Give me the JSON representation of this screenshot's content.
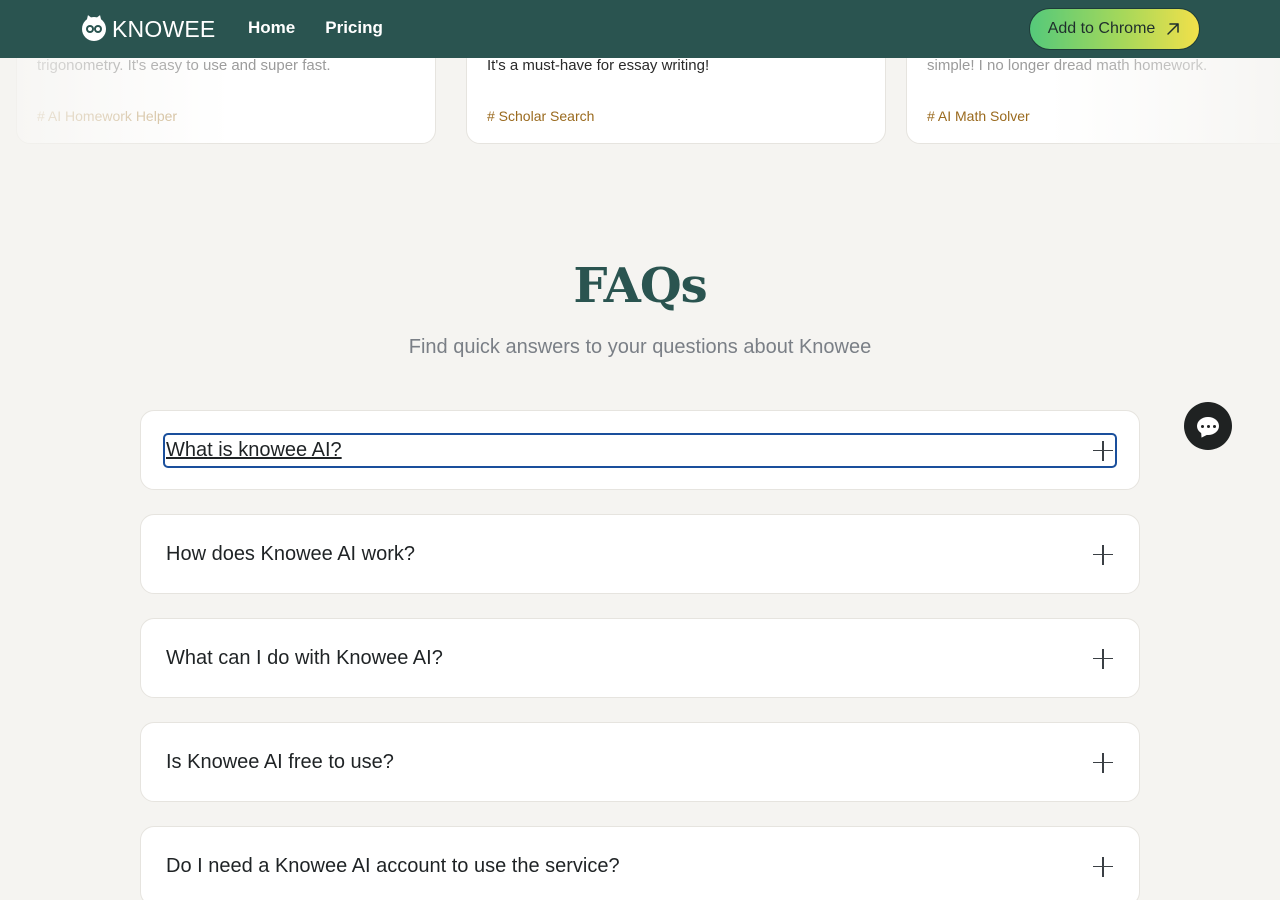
{
  "header": {
    "logo_text": "KNOWEE",
    "nav": [
      {
        "label": "Home"
      },
      {
        "label": "Pricing"
      }
    ],
    "cta_label": "Add to Chrome",
    "colors": {
      "header_bg": "#2a5450",
      "cta_gradient_start": "#55c97a",
      "cta_gradient_end": "#f2e04a"
    }
  },
  "testimonials": [
    {
      "quote": "trigonometry. It's easy to use and super fast.",
      "tag": "# AI Homework Helper"
    },
    {
      "quote": "It's a must-have for essay writing!",
      "tag": "# Scholar Search"
    },
    {
      "quote": "simple! I no longer dread math homework.",
      "tag": "# AI Math Solver"
    }
  ],
  "faq": {
    "title": "FAQs",
    "subtitle": "Find quick answers to your questions about Knowee",
    "items": [
      {
        "question": "What is knowee AI?"
      },
      {
        "question": "How does Knowee AI work?"
      },
      {
        "question": "What can I do with Knowee AI?"
      },
      {
        "question": "Is Knowee AI free to use?"
      },
      {
        "question": "Do I need a Knowee AI account to use the service?"
      }
    ]
  },
  "icons": {
    "chat": "chat-icon",
    "expand": "plus-icon",
    "external": "arrow-up-right-icon",
    "logo": "owl-logo-icon"
  }
}
